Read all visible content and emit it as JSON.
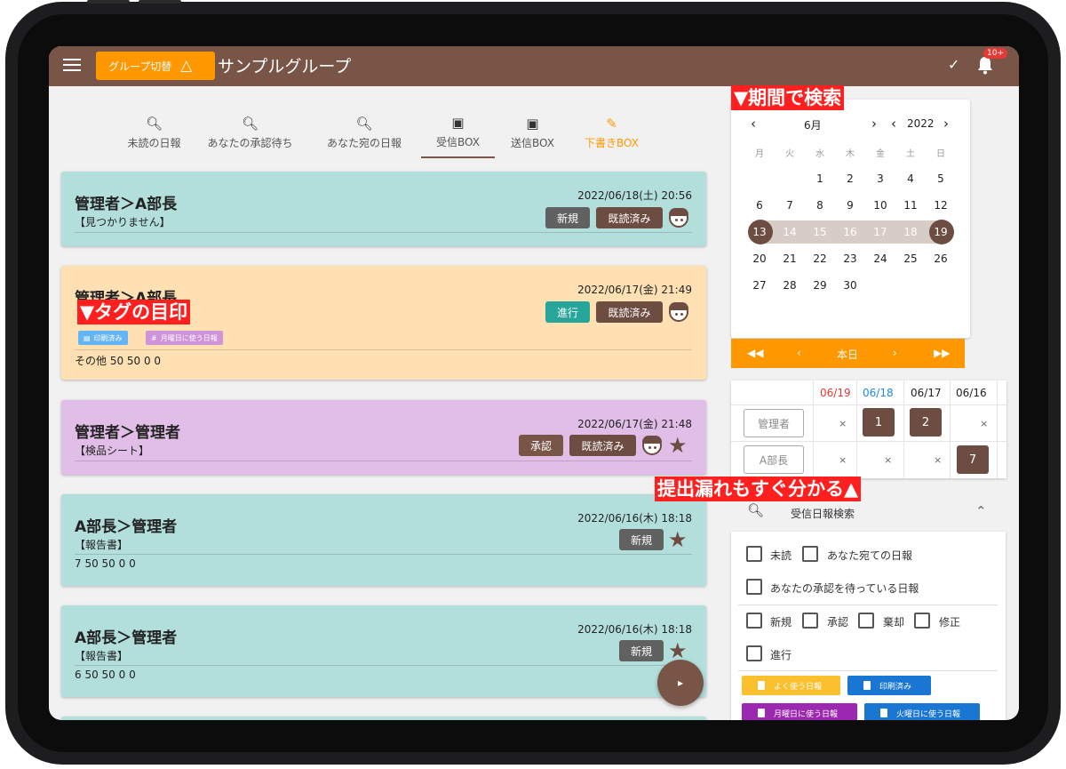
{
  "appbar": {
    "group_switch_label": "グループ切替",
    "group_name": "サンプルグループ",
    "notification_badge": "10+"
  },
  "tabs": [
    {
      "label": "未読の日報",
      "icon": "search-icon"
    },
    {
      "label": "あなたの承認待ち",
      "icon": "search-icon"
    },
    {
      "label": "あなた宛の日報",
      "icon": "search-icon"
    },
    {
      "label": "受信BOX",
      "icon": "inbox-icon"
    },
    {
      "label": "送信BOX",
      "icon": "outbox-icon"
    },
    {
      "label": "下書きBOX",
      "icon": "pencil-icon"
    }
  ],
  "reports": [
    {
      "title": "管理者＞A部長",
      "date": "2022/06/18(土) 20:56",
      "subtitle": "【見つかりません】",
      "status": "新規",
      "read": "既読済み",
      "body": "",
      "color": "#b2dfdb"
    },
    {
      "title": "管理者＞A部長",
      "date": "2022/06/17(金) 21:49",
      "subtitle": "",
      "status": "進行",
      "read": "既読済み",
      "tags": [
        "印刷済み",
        "月曜日に使う日報"
      ],
      "body": "その他 50 50 0 0",
      "color": "#ffe0b2"
    },
    {
      "title": "管理者＞管理者",
      "date": "2022/06/17(金) 21:48",
      "subtitle": "【検品シート】",
      "status": "承認",
      "read": "既読済み",
      "body": "",
      "color": "#e1bee7"
    },
    {
      "title": "A部長＞管理者",
      "date": "2022/06/16(木) 18:18",
      "subtitle": "【報告書】",
      "status": "新規",
      "read": "",
      "body": "7 50 50 0 0",
      "color": "#b2dfdb"
    },
    {
      "title": "A部長＞管理者",
      "date": "2022/06/16(木) 18:18",
      "subtitle": "【報告書】",
      "status": "新規",
      "read": "",
      "body": "6 50 50 0 0",
      "color": "#b2dfdb"
    }
  ],
  "annotations": {
    "tag_mark": "▼タグの目印",
    "period_search": "▼期間で検索",
    "missing_reports": "提出漏れもすぐ分かる▲"
  },
  "calendar": {
    "month": "6月",
    "year": "2022",
    "weekdays": [
      "月",
      "火",
      "水",
      "木",
      "金",
      "土",
      "日"
    ],
    "weeks": [
      [
        "",
        "",
        "1",
        "2",
        "3",
        "4",
        "5"
      ],
      [
        "6",
        "7",
        "8",
        "9",
        "10",
        "11",
        "12"
      ],
      [
        "13",
        "14",
        "15",
        "16",
        "17",
        "18",
        "19"
      ],
      [
        "20",
        "21",
        "22",
        "23",
        "24",
        "25",
        "26"
      ],
      [
        "27",
        "28",
        "29",
        "30",
        "",
        "",
        ""
      ]
    ],
    "range_start": "13",
    "range_end": "19",
    "today_label": "本日"
  },
  "submission_status": {
    "dates": [
      "06/19",
      "06/18",
      "06/17",
      "06/16"
    ],
    "date_colors": [
      "#e53935",
      "#1e88e5",
      "#222222",
      "#222222"
    ],
    "rows": [
      {
        "name": "管理者",
        "cells": [
          "×",
          "1",
          "2",
          "×"
        ]
      },
      {
        "name": "A部長",
        "cells": [
          "×",
          "×",
          "×",
          "7"
        ]
      }
    ]
  },
  "search": {
    "title": "受信日報検索",
    "filters": {
      "unread": "未読",
      "to_you": "あなた宛ての日報",
      "awaiting_approval": "あなたの承認を待っている日報",
      "new": "新規",
      "approved": "承認",
      "rejected": "棄却",
      "revision": "修正",
      "in_progress": "進行"
    },
    "tags": [
      {
        "label": "よく使う日報",
        "color": "#fbc02d"
      },
      {
        "label": "印刷済み",
        "color": "#1976d2"
      },
      {
        "label": "月曜日に使う日報",
        "color": "#9c27b0"
      },
      {
        "label": "火曜日に使う日報",
        "color": "#1976d2"
      }
    ]
  },
  "colors": {
    "brand": "#795548",
    "accent": "#ff9800"
  }
}
